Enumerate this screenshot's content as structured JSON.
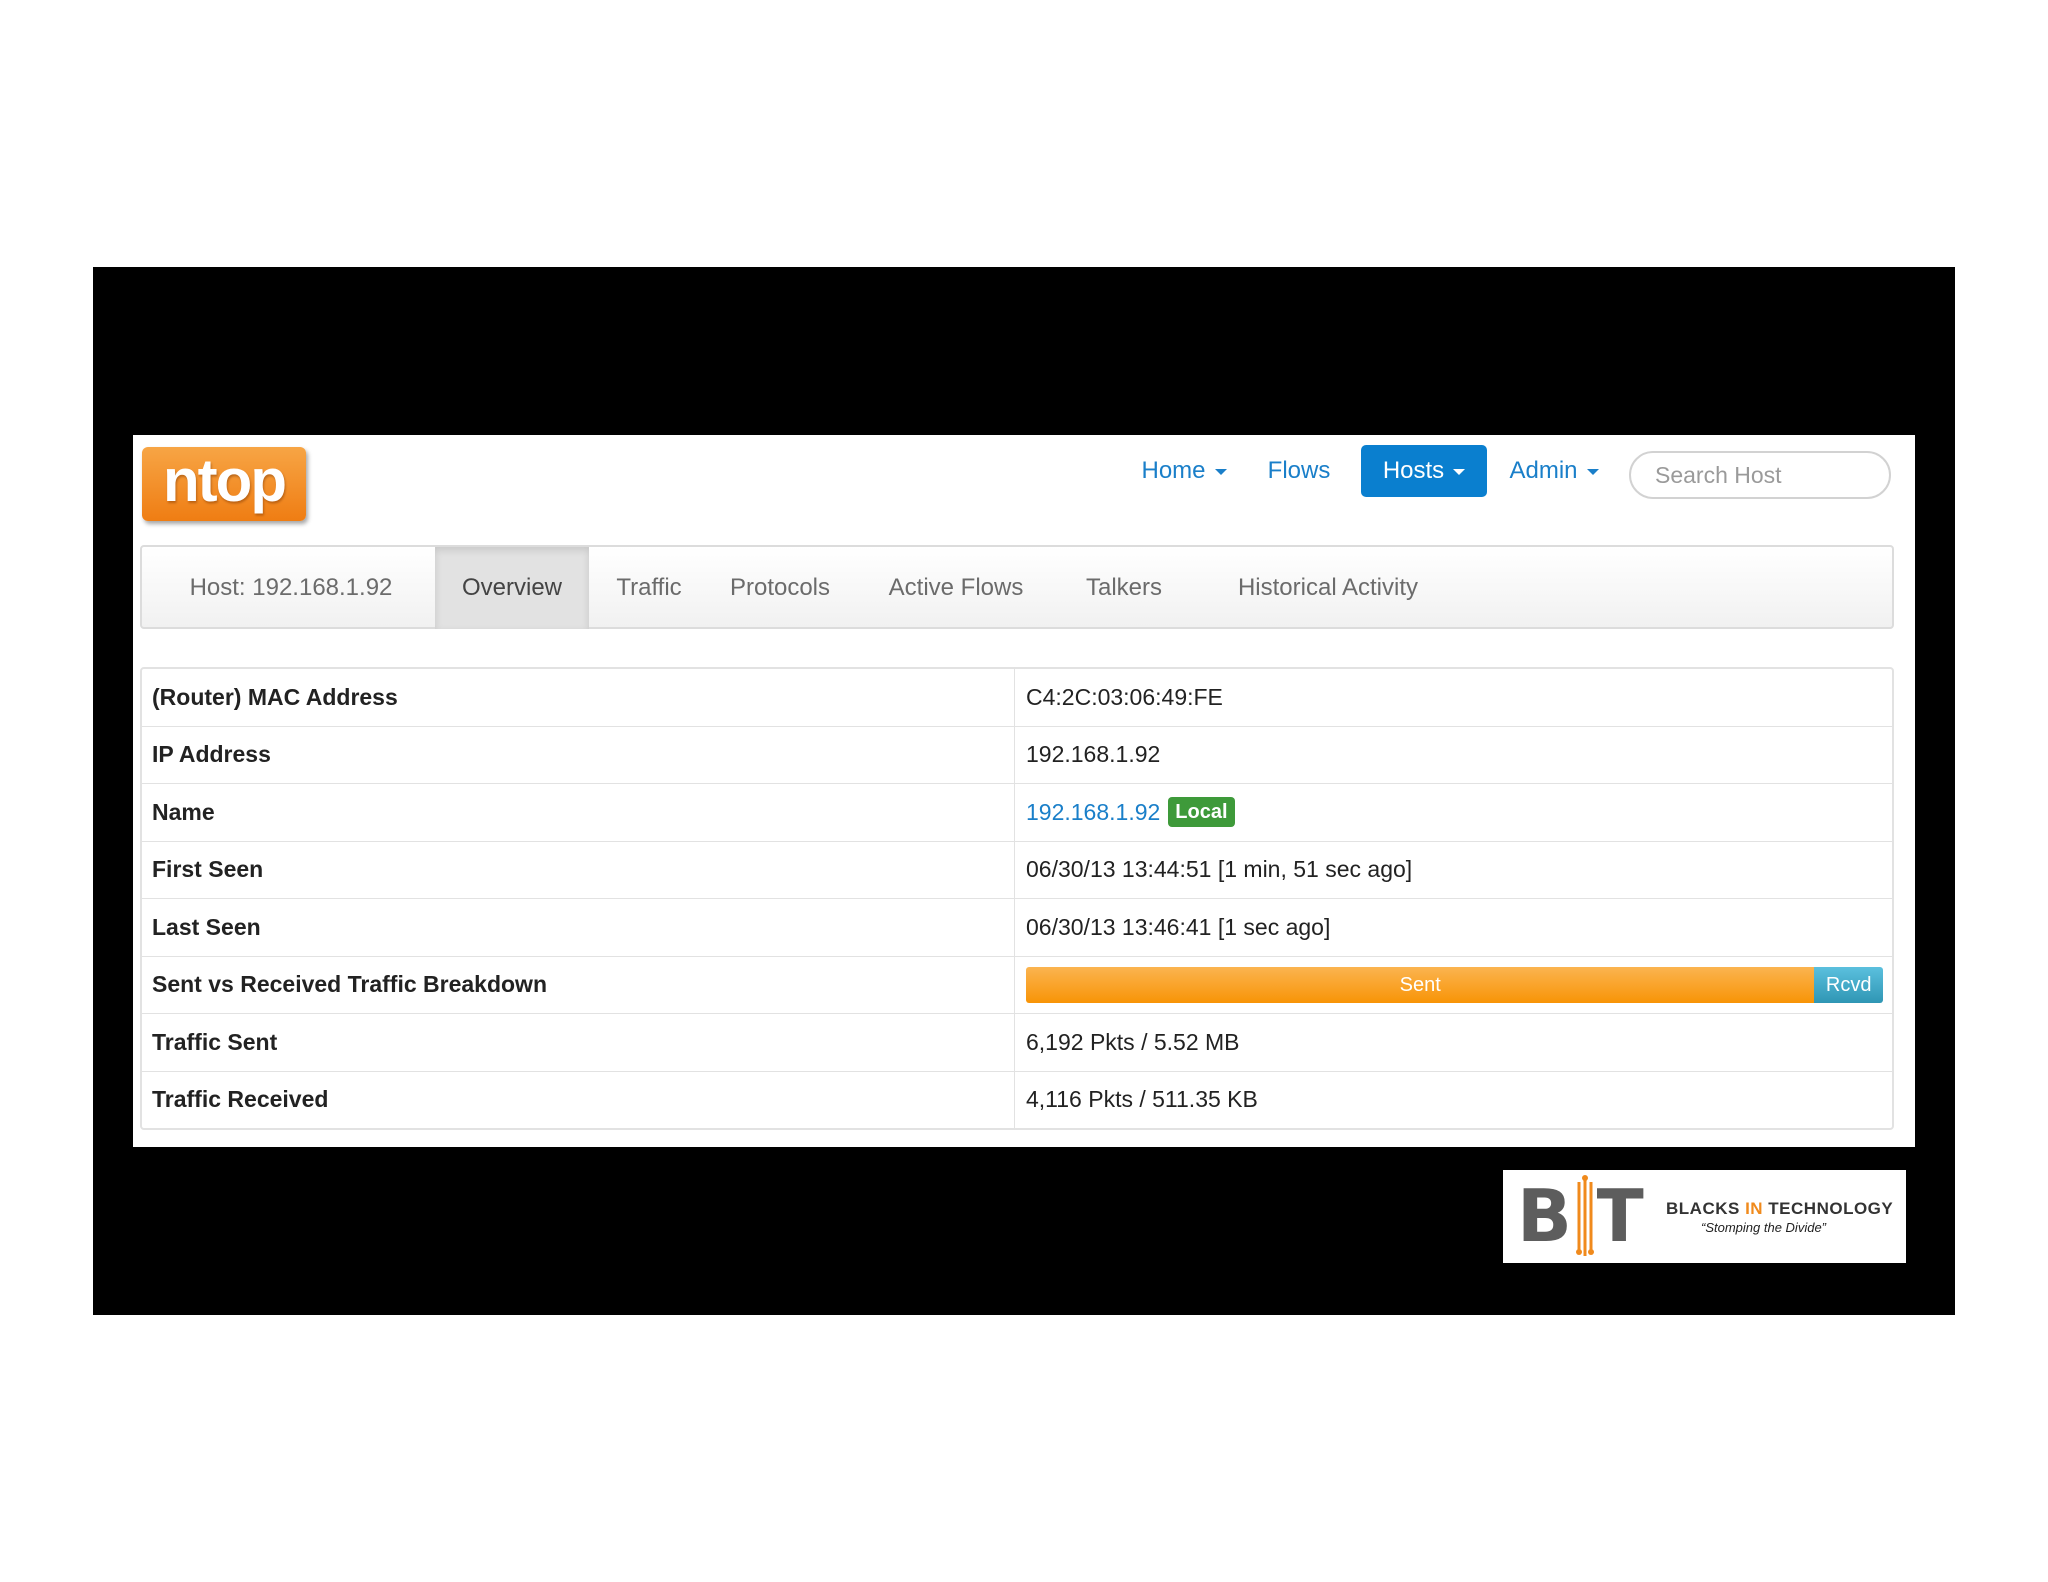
{
  "app": {
    "logo_text": "ntop"
  },
  "nav": {
    "items": [
      {
        "label": "Home",
        "dropdown": true,
        "active": false
      },
      {
        "label": "Flows",
        "dropdown": false,
        "active": false
      },
      {
        "label": "Hosts",
        "dropdown": true,
        "active": true
      },
      {
        "label": "Admin",
        "dropdown": true,
        "active": false
      }
    ],
    "search_placeholder": "Search Host"
  },
  "host_tabs": {
    "host_label": "Host: 192.168.1.92",
    "tabs": [
      {
        "label": "Overview",
        "active": true
      },
      {
        "label": "Traffic",
        "active": false
      },
      {
        "label": "Protocols",
        "active": false
      },
      {
        "label": "Active Flows",
        "active": false
      },
      {
        "label": "Talkers",
        "active": false
      },
      {
        "label": "Historical Activity",
        "active": false
      }
    ]
  },
  "info": {
    "mac_label": "(Router) MAC Address",
    "mac_value": "C4:2C:03:06:49:FE",
    "ip_label": "IP Address",
    "ip_value": "192.168.1.92",
    "name_label": "Name",
    "name_value": "192.168.1.92",
    "name_badge": "Local",
    "first_seen_label": "First Seen",
    "first_seen_value": "06/30/13 13:44:51 [1 min, 51 sec ago]",
    "last_seen_label": "Last Seen",
    "last_seen_value": "06/30/13 13:46:41 [1 sec ago]",
    "breakdown_label": "Sent vs Received Traffic Breakdown",
    "breakdown": {
      "sent_label": "Sent",
      "rcvd_label": "Rcvd",
      "sent_fraction": 0.92,
      "sent_color": "#f89406",
      "rcvd_color": "#2f96b4"
    },
    "traffic_sent_label": "Traffic Sent",
    "traffic_sent_value": "6,192 Pkts / 5.52 MB",
    "traffic_received_label": "Traffic Received",
    "traffic_received_value": "4,116 Pkts / 511.35 KB"
  },
  "branding": {
    "letters": "BIT",
    "title_part1": "BLACKS ",
    "title_part2": "IN",
    "title_part3": " TECHNOLOGY",
    "tagline": "“Stomping the Divide”",
    "accent_color": "#f08a1c"
  },
  "colors": {
    "nav_active": "#0a7fcf",
    "link": "#1a7fc9",
    "badge": "#3e9a3a",
    "logo_orange": "#ef7d13"
  }
}
